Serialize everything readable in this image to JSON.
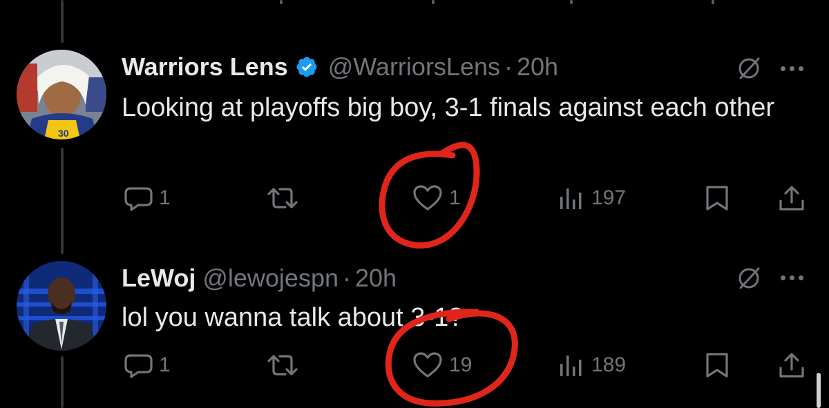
{
  "tweets": [
    {
      "name": "Warriors Lens",
      "verified": true,
      "handle": "@WarriorsLens",
      "separator": "·",
      "time": "20h",
      "text": "Looking at playoffs big boy, 3-1 finals against each other",
      "actions": {
        "replies": "1",
        "retweets": "",
        "likes": "1",
        "views": "197"
      }
    },
    {
      "name": "LeWoj",
      "verified": false,
      "handle": "@lewojespn",
      "separator": "·",
      "time": "20h",
      "text": "lol you wanna talk about 3-1?",
      "actions": {
        "replies": "1",
        "retweets": "",
        "likes": "19",
        "views": "189"
      }
    }
  ],
  "avatar_1_jersey_number": "30",
  "colors": {
    "background": "#000000",
    "text": "#e7e9ea",
    "muted": "#71767b",
    "verified": "#1d9bf0",
    "annotation": "#e0261b"
  },
  "icons": {
    "header": [
      "grok-icon",
      "more-icon"
    ],
    "actions": [
      "reply-icon",
      "retweet-icon",
      "like-icon",
      "views-icon",
      "bookmark-icon",
      "share-icon"
    ]
  }
}
